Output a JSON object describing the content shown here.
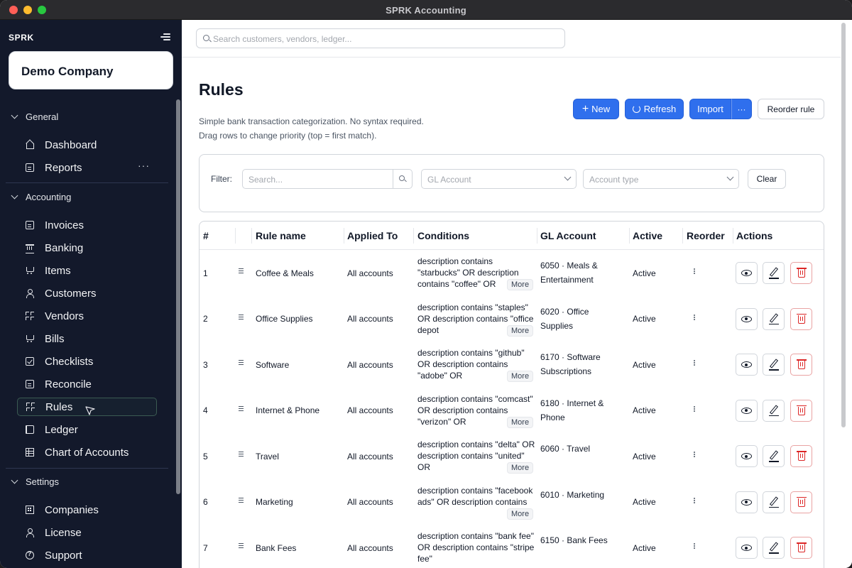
{
  "window": {
    "title": "SPRK Accounting"
  },
  "sidebar": {
    "brand": "SPRK",
    "company": "Demo Company",
    "sections": [
      {
        "label": "General",
        "items": [
          {
            "label": "Dashboard",
            "icon": "home-icon"
          },
          {
            "label": "Reports",
            "icon": "report-icon",
            "more": "···"
          }
        ]
      },
      {
        "label": "Accounting",
        "items": [
          {
            "label": "Invoices",
            "icon": "invoice-icon"
          },
          {
            "label": "Banking",
            "icon": "bank-icon"
          },
          {
            "label": "Items",
            "icon": "cart-icon"
          },
          {
            "label": "Customers",
            "icon": "user-icon"
          },
          {
            "label": "Vendors",
            "icon": "vendor-icon"
          },
          {
            "label": "Bills",
            "icon": "cart-icon"
          },
          {
            "label": "Checklists",
            "icon": "checklist-icon"
          },
          {
            "label": "Reconcile",
            "icon": "reconcile-icon"
          },
          {
            "label": "Rules",
            "icon": "rules-icon",
            "active": true
          },
          {
            "label": "Ledger",
            "icon": "book-icon"
          },
          {
            "label": "Chart of Accounts",
            "icon": "table-icon"
          }
        ]
      },
      {
        "label": "Settings",
        "items": [
          {
            "label": "Companies",
            "icon": "building-icon"
          },
          {
            "label": "License",
            "icon": "user-icon"
          },
          {
            "label": "Support",
            "icon": "help-icon"
          }
        ]
      }
    ]
  },
  "topbar": {
    "search_placeholder": "Search customers, vendors, ledger..."
  },
  "page": {
    "title": "Rules",
    "subtitle_1": "Simple bank transaction categorization. No syntax required.",
    "subtitle_2": "Drag rows to change priority (top = first match).",
    "buttons": {
      "new": "New",
      "refresh": "Refresh",
      "import": "Import",
      "import_more": "···",
      "reorder": "Reorder rule"
    }
  },
  "filter": {
    "label": "Filter:",
    "search_placeholder": "Search...",
    "gl_placeholder": "GL Account",
    "type_placeholder": "Account type",
    "clear": "Clear"
  },
  "table": {
    "headers": {
      "num": "#",
      "name": "Rule name",
      "applied": "Applied To",
      "conditions": "Conditions",
      "gl": "GL Account",
      "active": "Active",
      "reorder": "Reorder",
      "actions": "Actions"
    },
    "more_label": "More",
    "rows": [
      {
        "num": "1",
        "name": "Coffee & Meals",
        "applied": "All accounts",
        "conditions": "description contains \"starbucks\" OR description contains \"coffee\" OR",
        "more": true,
        "gl": "6050 · Meals & Entertainment",
        "active": "Active"
      },
      {
        "num": "2",
        "name": "Office Supplies",
        "applied": "All accounts",
        "conditions": "description contains \"staples\" OR description contains \"office depot",
        "more": true,
        "gl": "6020 · Office Supplies",
        "active": "Active"
      },
      {
        "num": "3",
        "name": "Software",
        "applied": "All accounts",
        "conditions": "description contains \"github\" OR description contains \"adobe\" OR",
        "more": true,
        "gl": "6170 · Software Subscriptions",
        "active": "Active"
      },
      {
        "num": "4",
        "name": "Internet & Phone",
        "applied": "All accounts",
        "conditions": "description contains \"comcast\" OR description contains \"verizon\" OR",
        "more": true,
        "gl": "6180 · Internet & Phone",
        "active": "Active"
      },
      {
        "num": "5",
        "name": "Travel",
        "applied": "All accounts",
        "conditions": "description contains \"delta\" OR description contains \"united\" OR",
        "more": true,
        "gl": "6060 · Travel",
        "active": "Active"
      },
      {
        "num": "6",
        "name": "Marketing",
        "applied": "All accounts",
        "conditions": "description contains \"facebook ads\" OR description contains",
        "more": true,
        "gl": "6010 · Marketing",
        "active": "Active"
      },
      {
        "num": "7",
        "name": "Bank Fees",
        "applied": "All accounts",
        "conditions": "description contains \"bank fee\" OR description contains \"stripe fee\"",
        "more": false,
        "gl": "6150 · Bank Fees",
        "active": "Active"
      }
    ]
  },
  "colors": {
    "primary": "#2f6fed",
    "sidebar_bg": "#13192b",
    "danger": "#dc2626"
  }
}
